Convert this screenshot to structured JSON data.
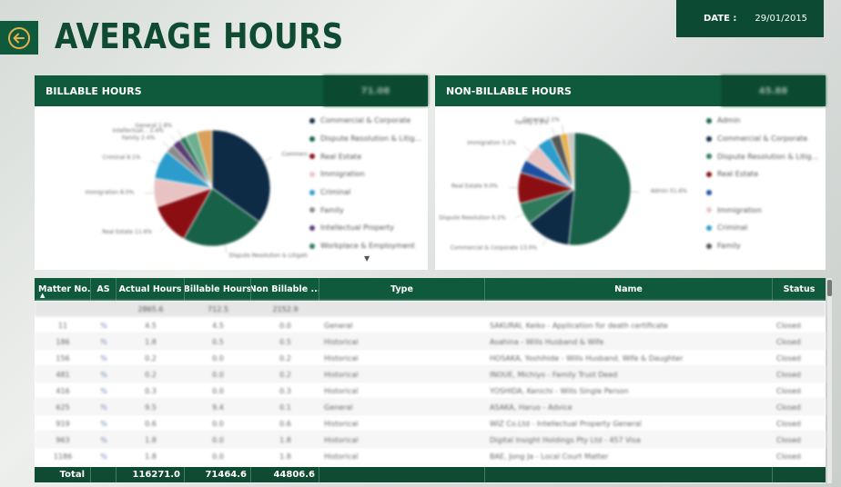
{
  "header": {
    "title": "AVERAGE HOURS",
    "date_label": "DATE :",
    "date_value": "29/01/2015"
  },
  "billable_panel": {
    "title": "BILLABLE HOURS",
    "kpi": "71.08",
    "legend": [
      {
        "label": "Commercial & Corporate",
        "color": "#0d2b45"
      },
      {
        "label": "Dispute Resolution & Litig...",
        "color": "#176148"
      },
      {
        "label": "Real Estate",
        "color": "#8b0f12"
      },
      {
        "label": "Immigration",
        "color": "#e9c3c3"
      },
      {
        "label": "Criminal",
        "color": "#2b9ccc"
      },
      {
        "label": "Family",
        "color": "#8a8a8a"
      },
      {
        "label": "Intellectual Property",
        "color": "#5a3b72"
      },
      {
        "label": "Workplace & Employment",
        "color": "#2f7a5a"
      }
    ],
    "chart_data": {
      "type": "pie",
      "slices": [
        {
          "label": "Commercial & Corporate",
          "value": 34.9,
          "display": "34.9%"
        },
        {
          "label": "Dispute Resolution & Litigation",
          "value": 23.2,
          "display": "23.2%"
        },
        {
          "label": "Real Estate",
          "value": 11.6,
          "display": "11.6%"
        },
        {
          "label": "Immigration",
          "value": 8.0,
          "display": "8.0%"
        },
        {
          "label": "Criminal",
          "value": 8.1,
          "display": "8.1%"
        },
        {
          "label": "Family",
          "value": 2.4,
          "display": "2.4%"
        },
        {
          "label": "Intellectual...",
          "value": 2.4,
          "display": "2.4%"
        },
        {
          "label": "General",
          "value": 1.8,
          "display": "1.8%"
        },
        {
          "label": "Workplace & Employment",
          "value": 3.4,
          "display": ""
        },
        {
          "label": "Other",
          "value": 4.2,
          "display": ""
        }
      ]
    }
  },
  "non_billable_panel": {
    "title": "NON-BILLABLE HOURS",
    "kpi": "45.88",
    "legend": [
      {
        "label": "Admin",
        "color": "#176148"
      },
      {
        "label": "Commercial & Corporate",
        "color": "#0d2b45"
      },
      {
        "label": "Dispute Resolution & Litig...",
        "color": "#2f7a5a"
      },
      {
        "label": "Real Estate",
        "color": "#8b0f12"
      },
      {
        "label": "",
        "color": "#1d4fa0"
      },
      {
        "label": "Immigration",
        "color": "#e9c3c3"
      },
      {
        "label": "Criminal",
        "color": "#2b9ccc"
      },
      {
        "label": "Family",
        "color": "#555555"
      }
    ],
    "chart_data": {
      "type": "pie",
      "slices": [
        {
          "label": "Admin",
          "value": 51.6,
          "display": "51.6%"
        },
        {
          "label": "Commercial & Corporate",
          "value": 13.0,
          "display": "13.0%"
        },
        {
          "label": "Dispute Resolution",
          "value": 6.2,
          "display": "6.2%"
        },
        {
          "label": "Real Estate",
          "value": 9.0,
          "display": "9.0%"
        },
        {
          "label": "Other",
          "value": 3.8,
          "display": ""
        },
        {
          "label": "Immigration",
          "value": 5.2,
          "display": "5.2%"
        },
        {
          "label": "Criminal",
          "value": 4.2,
          "display": ""
        },
        {
          "label": "Family",
          "value": 2.9,
          "display": "2.9%"
        },
        {
          "label": "General",
          "value": 2.1,
          "display": "2.1%"
        },
        {
          "label": "Tax",
          "value": 2.0,
          "display": ""
        }
      ]
    }
  },
  "table": {
    "columns": [
      "Matter No.",
      "AS",
      "Actual Hours",
      "Billable Hours",
      "Non Billable ...",
      "Type",
      "Name",
      "Status"
    ],
    "totals_row": {
      "actual": "2865.6",
      "billable": "712.5",
      "non_billable": "2152.9"
    },
    "rows": [
      {
        "matter": "11",
        "as": "%",
        "actual": "4.5",
        "billable": "4.5",
        "non_billable": "0.0",
        "type": "General",
        "name": "SAKURAI, Keiko - Application for death certificate",
        "status": "Closed"
      },
      {
        "matter": "186",
        "as": "%",
        "actual": "1.8",
        "billable": "0.5",
        "non_billable": "0.5",
        "type": "Historical",
        "name": "Asahina - Wills Husband & Wife",
        "status": "Closed"
      },
      {
        "matter": "156",
        "as": "%",
        "actual": "0.2",
        "billable": "0.0",
        "non_billable": "0.2",
        "type": "Historical",
        "name": "HOSAKA, Yoshihide - Wills Husband, Wife & Daughter",
        "status": "Closed"
      },
      {
        "matter": "481",
        "as": "%",
        "actual": "0.2",
        "billable": "0.0",
        "non_billable": "0.2",
        "type": "Historical",
        "name": "INOUE, Michiyo - Family Trust Deed",
        "status": "Closed"
      },
      {
        "matter": "416",
        "as": "%",
        "actual": "0.3",
        "billable": "0.0",
        "non_billable": "0.3",
        "type": "Historical",
        "name": "YOSHIDA, Kenichi - Wills Single Person",
        "status": "Closed"
      },
      {
        "matter": "625",
        "as": "%",
        "actual": "9.5",
        "billable": "9.4",
        "non_billable": "0.1",
        "type": "General",
        "name": "ASAKA, Haruo - Advice",
        "status": "Closed"
      },
      {
        "matter": "919",
        "as": "%",
        "actual": "0.6",
        "billable": "0.0",
        "non_billable": "0.6",
        "type": "Historical",
        "name": "WIZ Co.Ltd - Intellectual Property General",
        "status": "Closed"
      },
      {
        "matter": "963",
        "as": "%",
        "actual": "1.8",
        "billable": "0.0",
        "non_billable": "1.8",
        "type": "Historical",
        "name": "Digital Insight Holdings Pty Ltd - 457 Visa",
        "status": "Closed"
      },
      {
        "matter": "1186",
        "as": "%",
        "actual": "1.8",
        "billable": "0.0",
        "non_billable": "1.8",
        "type": "Historical",
        "name": "BAE, Jong Ja - Local Court Matter",
        "status": "Closed"
      }
    ],
    "footer": {
      "label": "Total",
      "actual": "116271.0",
      "billable": "71464.6",
      "non_billable": "44806.6"
    }
  },
  "colors": {
    "brand": "#0f5a3c",
    "brand_dark": "#0d4a33",
    "title": "#0f4a33"
  }
}
